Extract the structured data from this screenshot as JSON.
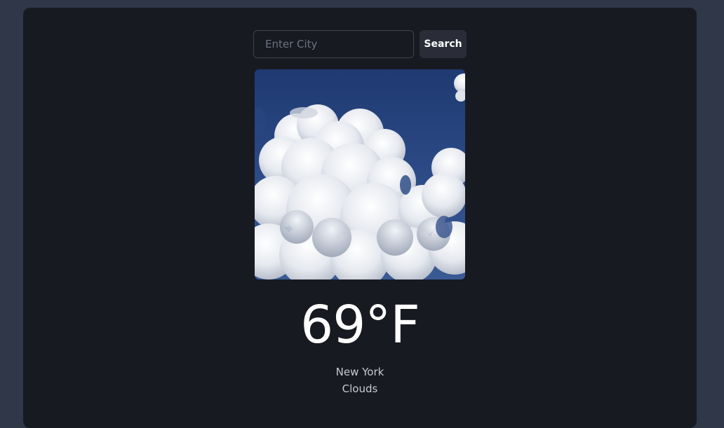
{
  "search": {
    "placeholder": "Enter City",
    "value": "",
    "button_label": "Search"
  },
  "weather": {
    "image_icon": "clouds-image",
    "temperature": "69°F",
    "city": "New York",
    "condition": "Clouds"
  },
  "colors": {
    "page_bg": "#2f3748",
    "card_bg": "#181a22",
    "button_bg": "#2a2d38",
    "sky_blue": "#2c4a86"
  }
}
